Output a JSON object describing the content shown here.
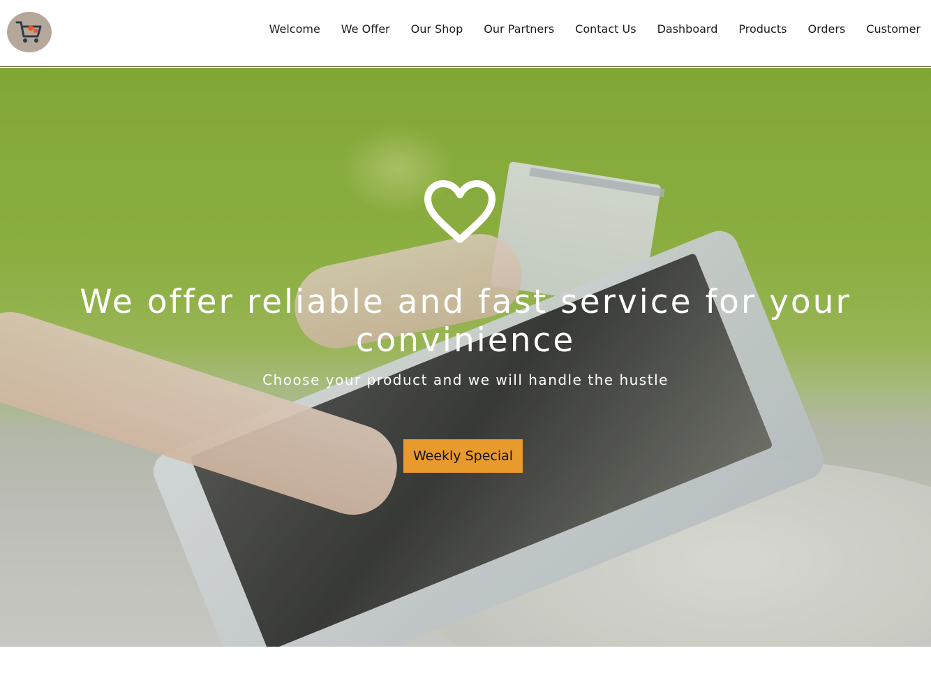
{
  "navbar": {
    "logo_icon": "shopping-cart-icon",
    "links": [
      {
        "label": "Welcome"
      },
      {
        "label": "We Offer"
      },
      {
        "label": "Our Shop"
      },
      {
        "label": "Our Partners"
      },
      {
        "label": "Contact Us"
      },
      {
        "label": "Dashboard"
      },
      {
        "label": "Products"
      },
      {
        "label": "Orders"
      },
      {
        "label": "Customer"
      }
    ]
  },
  "hero": {
    "icon": "heart-icon",
    "headline": "We offer reliable and fast service for your convinience",
    "subheadline": "Choose your product and we will handle the hustle",
    "cta_label": "Weekly Special"
  },
  "colors": {
    "accent": "#e89a2c",
    "logo_bg": "#b5a89b",
    "hero_green": "#9bc04a",
    "text_dark": "#1a1a1a"
  }
}
